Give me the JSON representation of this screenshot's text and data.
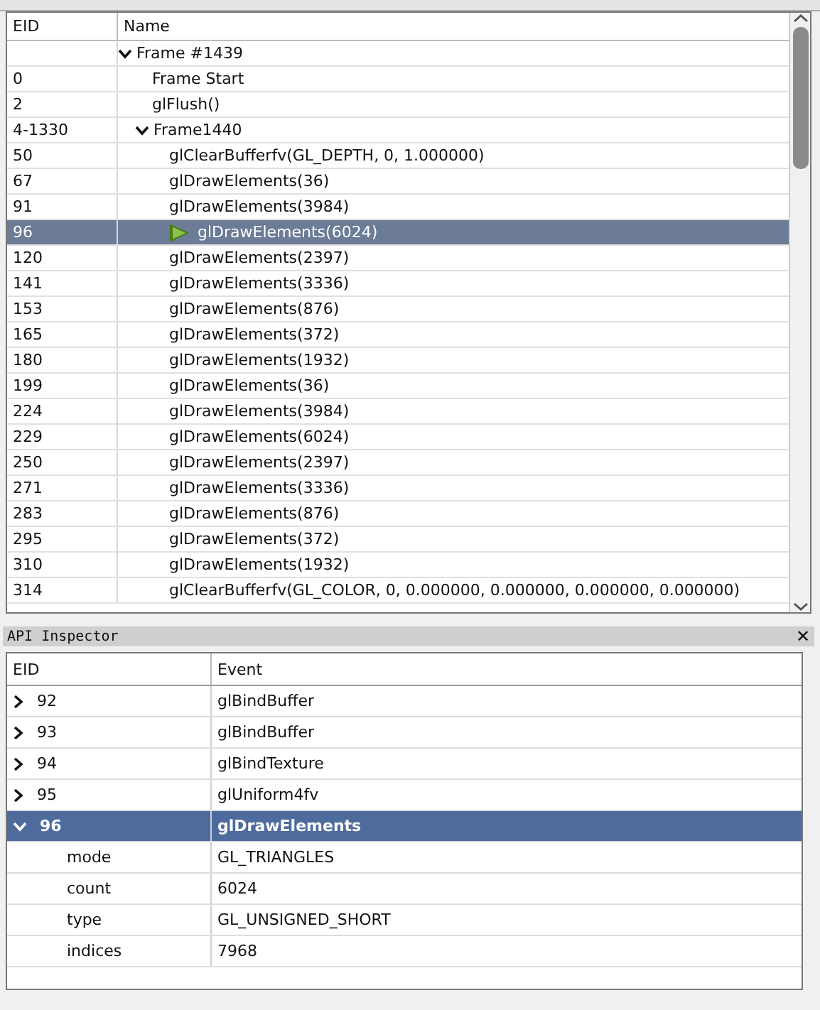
{
  "event_browser": {
    "columns": [
      "EID",
      "Name"
    ],
    "rows": [
      {
        "eid": "",
        "name": "Frame #1439",
        "expanded": true,
        "selected": false,
        "children": [
          {
            "eid": "0",
            "name": "Frame Start",
            "selected": false
          },
          {
            "eid": "2",
            "name": "glFlush()",
            "selected": false
          },
          {
            "eid": "4-1330",
            "name": "Frame1440",
            "expanded": true,
            "selected": false,
            "children": [
              {
                "eid": "50",
                "name": "glClearBufferfv(GL_DEPTH, 0, 1.000000)",
                "selected": false
              },
              {
                "eid": "67",
                "name": "glDrawElements(36)",
                "selected": false
              },
              {
                "eid": "91",
                "name": "glDrawElements(3984)",
                "selected": false
              },
              {
                "eid": "96",
                "name": "glDrawElements(6024)",
                "selected": true
              },
              {
                "eid": "120",
                "name": "glDrawElements(2397)",
                "selected": false
              },
              {
                "eid": "141",
                "name": "glDrawElements(3336)",
                "selected": false
              },
              {
                "eid": "153",
                "name": "glDrawElements(876)",
                "selected": false
              },
              {
                "eid": "165",
                "name": "glDrawElements(372)",
                "selected": false
              },
              {
                "eid": "180",
                "name": "glDrawElements(1932)",
                "selected": false
              },
              {
                "eid": "199",
                "name": "glDrawElements(36)",
                "selected": false
              },
              {
                "eid": "224",
                "name": "glDrawElements(3984)",
                "selected": false
              },
              {
                "eid": "229",
                "name": "glDrawElements(6024)",
                "selected": false
              },
              {
                "eid": "250",
                "name": "glDrawElements(2397)",
                "selected": false
              },
              {
                "eid": "271",
                "name": "glDrawElements(3336)",
                "selected": false
              },
              {
                "eid": "283",
                "name": "glDrawElements(876)",
                "selected": false
              },
              {
                "eid": "295",
                "name": "glDrawElements(372)",
                "selected": false
              },
              {
                "eid": "310",
                "name": "glDrawElements(1932)",
                "selected": false
              },
              {
                "eid": "314",
                "name": "glClearBufferfv(GL_COLOR, 0, 0.000000, 0.000000, 0.000000, 0.000000)",
                "selected": false
              }
            ]
          }
        ]
      }
    ]
  },
  "api_inspector": {
    "title": "API Inspector",
    "close": "✕",
    "columns": [
      "EID",
      "Event"
    ],
    "rows": [
      {
        "eid": "92",
        "event": "glBindBuffer",
        "expanded": false,
        "selected": false
      },
      {
        "eid": "93",
        "event": "glBindBuffer",
        "expanded": false,
        "selected": false
      },
      {
        "eid": "94",
        "event": "glBindTexture",
        "expanded": false,
        "selected": false
      },
      {
        "eid": "95",
        "event": "glUniform4fv",
        "expanded": false,
        "selected": false
      },
      {
        "eid": "96",
        "event": "glDrawElements",
        "expanded": true,
        "selected": true,
        "children": [
          {
            "name": "mode",
            "value": "GL_TRIANGLES"
          },
          {
            "name": "count",
            "value": "6024"
          },
          {
            "name": "type",
            "value": "GL_UNSIGNED_SHORT"
          },
          {
            "name": "indices",
            "value": "7968"
          }
        ]
      }
    ]
  }
}
